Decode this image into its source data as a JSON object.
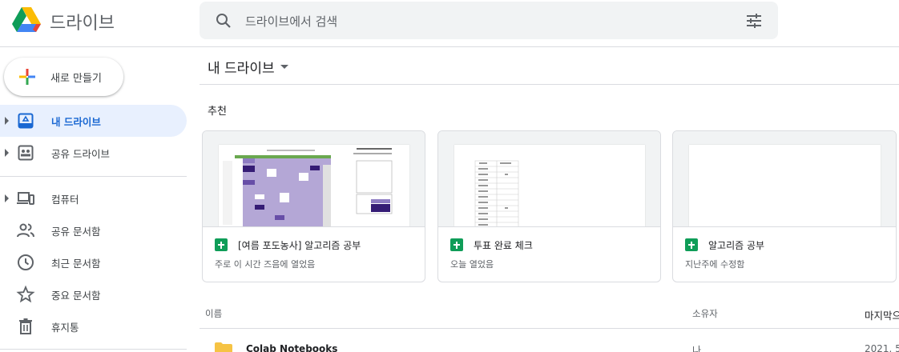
{
  "header": {
    "app_title": "드라이브",
    "search_placeholder": "드라이브에서 검색"
  },
  "sidebar": {
    "new_button_label": "새로 만들기",
    "items": [
      {
        "label": "내 드라이브",
        "icon": "my-drive-icon",
        "active": true
      },
      {
        "label": "공유 드라이브",
        "icon": "shared-drives-icon"
      },
      {
        "label": "컴퓨터",
        "icon": "computer-icon"
      },
      {
        "label": "공유 문서함",
        "icon": "people-icon"
      },
      {
        "label": "최근 문서함",
        "icon": "clock-icon"
      },
      {
        "label": "중요 문서함",
        "icon": "star-icon"
      },
      {
        "label": "휴지통",
        "icon": "trash-icon"
      }
    ]
  },
  "main": {
    "title": "내 드라이브",
    "suggested_label": "추천",
    "cards": [
      {
        "name": "[여름 포도농사] 알고리즘 공부",
        "subtitle": "주로 이 시간 즈음에 열었음",
        "icon": "sheets-icon"
      },
      {
        "name": "투표 완료 체크",
        "subtitle": "오늘 열었음",
        "icon": "sheets-icon"
      },
      {
        "name": "알고리즘 공부",
        "subtitle": "지난주에 수정함",
        "icon": "sheets-icon"
      }
    ],
    "columns": {
      "name": "이름",
      "owner": "소유자",
      "modified": "마지막으"
    },
    "rows": [
      {
        "name": "Colab Notebooks",
        "owner": "나",
        "modified": "2021. 5",
        "icon": "folder-icon"
      }
    ]
  },
  "colors": {
    "accent": "#1967d2",
    "active_bg": "#e8f0fe",
    "sheets_green": "#0f9d58",
    "folder_yellow": "#f6c344",
    "heat_purple": "#8e7cc3",
    "heat_dark": "#351c75"
  }
}
